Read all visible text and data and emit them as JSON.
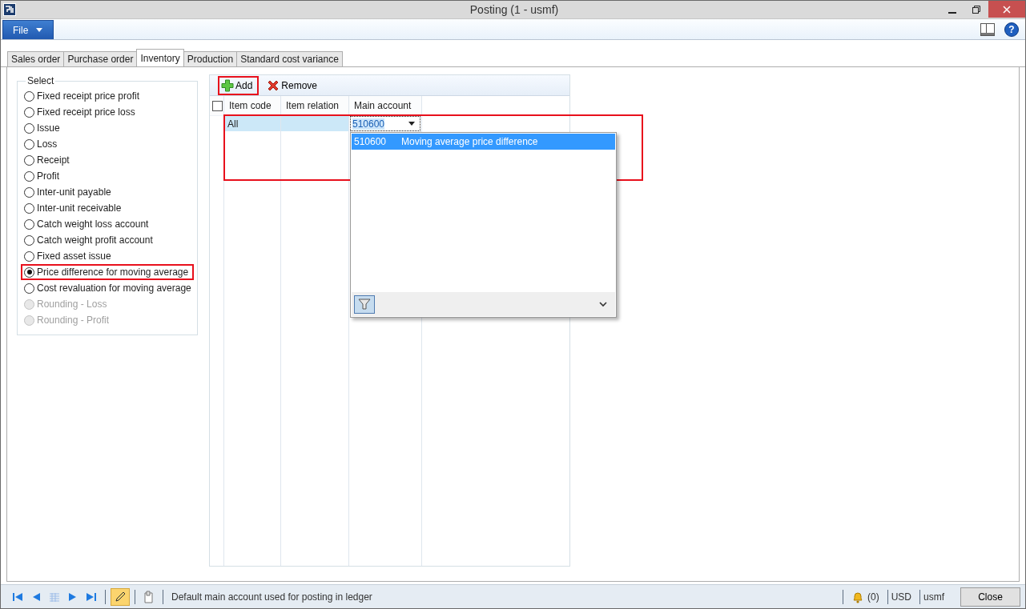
{
  "window": {
    "title": "Posting (1 - usmf)"
  },
  "menu": {
    "file": "File",
    "help": "?"
  },
  "tabs": [
    {
      "label": "Sales order",
      "selected": false
    },
    {
      "label": "Purchase order",
      "selected": false
    },
    {
      "label": "Inventory",
      "selected": true
    },
    {
      "label": "Production",
      "selected": false
    },
    {
      "label": "Standard cost variance",
      "selected": false
    }
  ],
  "select_group": {
    "title": "Select",
    "options": [
      {
        "label": "Fixed receipt price profit",
        "selected": false,
        "disabled": false,
        "annotated": false
      },
      {
        "label": "Fixed receipt price loss",
        "selected": false,
        "disabled": false,
        "annotated": false
      },
      {
        "label": "Issue",
        "selected": false,
        "disabled": false,
        "annotated": false
      },
      {
        "label": "Loss",
        "selected": false,
        "disabled": false,
        "annotated": false
      },
      {
        "label": "Receipt",
        "selected": false,
        "disabled": false,
        "annotated": false
      },
      {
        "label": "Profit",
        "selected": false,
        "disabled": false,
        "annotated": false
      },
      {
        "label": "Inter-unit payable",
        "selected": false,
        "disabled": false,
        "annotated": false
      },
      {
        "label": "Inter-unit receivable",
        "selected": false,
        "disabled": false,
        "annotated": false
      },
      {
        "label": "Catch weight loss account",
        "selected": false,
        "disabled": false,
        "annotated": false
      },
      {
        "label": "Catch weight profit account",
        "selected": false,
        "disabled": false,
        "annotated": false
      },
      {
        "label": "Fixed asset issue",
        "selected": false,
        "disabled": false,
        "annotated": false
      },
      {
        "label": "Price difference for moving average",
        "selected": true,
        "disabled": false,
        "annotated": true
      },
      {
        "label": "Cost revaluation for moving average",
        "selected": false,
        "disabled": false,
        "annotated": false
      },
      {
        "label": "Rounding - Loss",
        "selected": false,
        "disabled": true,
        "annotated": false
      },
      {
        "label": "Rounding - Profit",
        "selected": false,
        "disabled": true,
        "annotated": false
      }
    ]
  },
  "toolbar": {
    "buttons": [
      {
        "label": "Add",
        "kind": "add",
        "annotated": true
      },
      {
        "label": "Remove",
        "kind": "remove",
        "annotated": false
      }
    ]
  },
  "grid": {
    "select_all": {
      "checked": false
    },
    "columns": [
      "Item code",
      "Item relation",
      "Main account"
    ],
    "rows": [
      {
        "item_code": "All",
        "main_account": "510600",
        "selected": true,
        "annotated": true
      }
    ]
  },
  "lookup": {
    "rows": [
      {
        "account": "510600",
        "name": "Moving average price difference",
        "selected": true
      }
    ]
  },
  "status_bar": {
    "message": "Default main account used for posting in ledger",
    "notifications": "(0)",
    "currency": "USD",
    "company": "usmf",
    "close": "Close"
  }
}
